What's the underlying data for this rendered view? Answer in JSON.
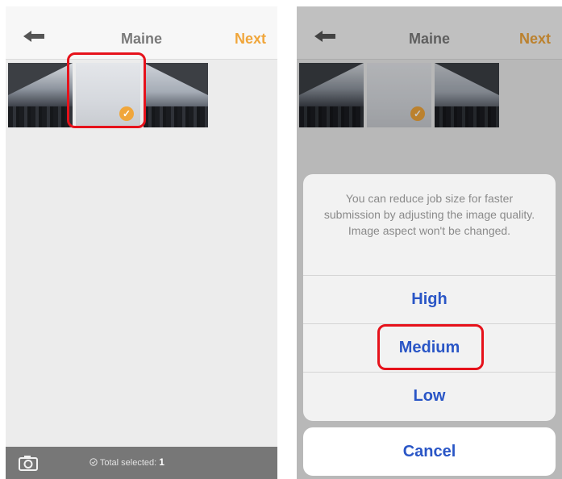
{
  "left_screen": {
    "nav": {
      "title": "Maine",
      "next_label": "Next"
    },
    "footer": {
      "total_label": "Total selected:",
      "total_count": "1"
    }
  },
  "right_screen": {
    "nav": {
      "title": "Maine",
      "next_label": "Next"
    },
    "sheet": {
      "message": "You can reduce job size for faster submission by adjusting the image quality. Image aspect won't be changed.",
      "options": [
        "High",
        "Medium",
        "Low"
      ],
      "cancel_label": "Cancel"
    }
  },
  "icons": {
    "back": "back-arrow-icon",
    "check": "checkmark-icon",
    "camera": "camera-icon",
    "total": "check-circle-icon"
  },
  "colors": {
    "accent_orange": "#f0a63b",
    "action_blue": "#2a56c6",
    "highlight_red": "#e6121b"
  }
}
